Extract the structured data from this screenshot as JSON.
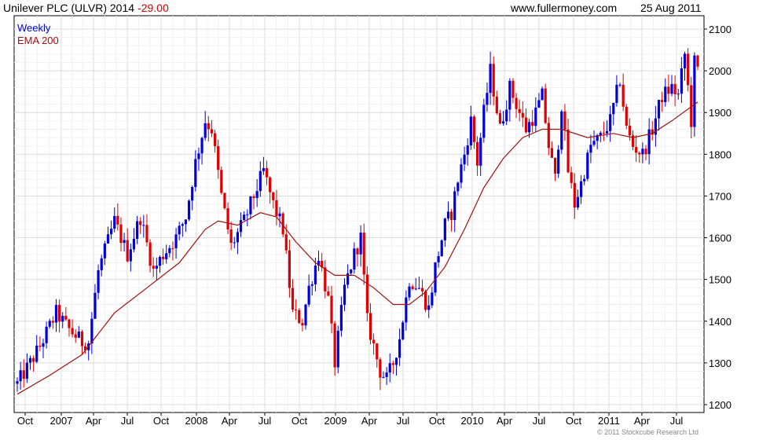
{
  "header": {
    "title": "Unilever PLC (ULVR) 2014",
    "change": "-29.00",
    "site": "www.fullermoney.com",
    "date": "25 Aug 2011"
  },
  "legend": {
    "weekly": "Weekly",
    "ema": "EMA 200"
  },
  "copyright": "© 2011 Stockcube Research Ltd",
  "colors": {
    "up": "#0000dd",
    "down": "#dd0000",
    "ema": "#a01010",
    "grid": "#dcdcdc"
  },
  "chart_data": {
    "type": "line",
    "series_style": "weekly high-low bars",
    "ylim": [
      1200,
      2100
    ],
    "yticks": [
      1200,
      1300,
      1400,
      1500,
      1600,
      1700,
      1800,
      1900,
      2000,
      2100
    ],
    "xticks": [
      "Oct",
      "2007",
      "Apr",
      "Jul",
      "Oct",
      "2008",
      "Apr",
      "Jul",
      "Oct",
      "2009",
      "Apr",
      "Jul",
      "Oct",
      "2010",
      "Apr",
      "Jul",
      "Oct",
      "2011",
      "Apr",
      "Jul"
    ],
    "close_path": [
      [
        0,
        1250
      ],
      [
        4,
        1300
      ],
      [
        7,
        1340
      ],
      [
        12,
        1420
      ],
      [
        16,
        1380
      ],
      [
        20,
        1350
      ],
      [
        22,
        1350
      ],
      [
        25,
        1520
      ],
      [
        30,
        1640
      ],
      [
        34,
        1560
      ],
      [
        38,
        1650
      ],
      [
        42,
        1520
      ],
      [
        45,
        1560
      ],
      [
        49,
        1600
      ],
      [
        52,
        1650
      ],
      [
        55,
        1780
      ],
      [
        58,
        1880
      ],
      [
        60,
        1860
      ],
      [
        63,
        1700
      ],
      [
        66,
        1580
      ],
      [
        70,
        1640
      ],
      [
        73,
        1700
      ],
      [
        76,
        1760
      ],
      [
        79,
        1680
      ],
      [
        82,
        1620
      ],
      [
        85,
        1420
      ],
      [
        88,
        1400
      ],
      [
        90,
        1480
      ],
      [
        93,
        1560
      ],
      [
        96,
        1450
      ],
      [
        98,
        1300
      ],
      [
        101,
        1480
      ],
      [
        104,
        1560
      ],
      [
        106,
        1600
      ],
      [
        108,
        1400
      ],
      [
        110,
        1340
      ],
      [
        112,
        1280
      ],
      [
        114,
        1260
      ],
      [
        116,
        1300
      ],
      [
        118,
        1360
      ],
      [
        121,
        1500
      ],
      [
        124,
        1480
      ],
      [
        127,
        1430
      ],
      [
        129,
        1530
      ],
      [
        132,
        1630
      ],
      [
        134,
        1660
      ],
      [
        136,
        1740
      ],
      [
        138,
        1800
      ],
      [
        140,
        1880
      ],
      [
        142,
        1780
      ],
      [
        144,
        1900
      ],
      [
        146,
        2000
      ],
      [
        149,
        1860
      ],
      [
        152,
        1960
      ],
      [
        155,
        1900
      ],
      [
        157,
        1860
      ],
      [
        160,
        1900
      ],
      [
        162,
        1940
      ],
      [
        164,
        1820
      ],
      [
        166,
        1740
      ],
      [
        168,
        1920
      ],
      [
        170,
        1760
      ],
      [
        172,
        1680
      ],
      [
        174,
        1730
      ],
      [
        177,
        1820
      ],
      [
        180,
        1840
      ],
      [
        183,
        1880
      ],
      [
        186,
        1980
      ],
      [
        188,
        1860
      ],
      [
        190,
        1820
      ],
      [
        193,
        1800
      ],
      [
        196,
        1860
      ],
      [
        199,
        1940
      ],
      [
        202,
        1960
      ],
      [
        204,
        1940
      ],
      [
        206,
        2040
      ],
      [
        207,
        1960
      ],
      [
        208,
        1880
      ],
      [
        209,
        2020
      ],
      [
        210,
        2000
      ]
    ],
    "ema_path": [
      [
        0,
        1225
      ],
      [
        10,
        1270
      ],
      [
        20,
        1320
      ],
      [
        30,
        1420
      ],
      [
        40,
        1480
      ],
      [
        50,
        1540
      ],
      [
        58,
        1620
      ],
      [
        62,
        1640
      ],
      [
        68,
        1630
      ],
      [
        75,
        1660
      ],
      [
        80,
        1650
      ],
      [
        86,
        1590
      ],
      [
        92,
        1540
      ],
      [
        98,
        1510
      ],
      [
        104,
        1510
      ],
      [
        110,
        1480
      ],
      [
        116,
        1440
      ],
      [
        121,
        1440
      ],
      [
        126,
        1470
      ],
      [
        132,
        1530
      ],
      [
        138,
        1620
      ],
      [
        144,
        1720
      ],
      [
        150,
        1790
      ],
      [
        156,
        1840
      ],
      [
        162,
        1860
      ],
      [
        168,
        1860
      ],
      [
        176,
        1840
      ],
      [
        184,
        1850
      ],
      [
        190,
        1840
      ],
      [
        196,
        1850
      ],
      [
        202,
        1880
      ],
      [
        210,
        1925
      ]
    ]
  }
}
